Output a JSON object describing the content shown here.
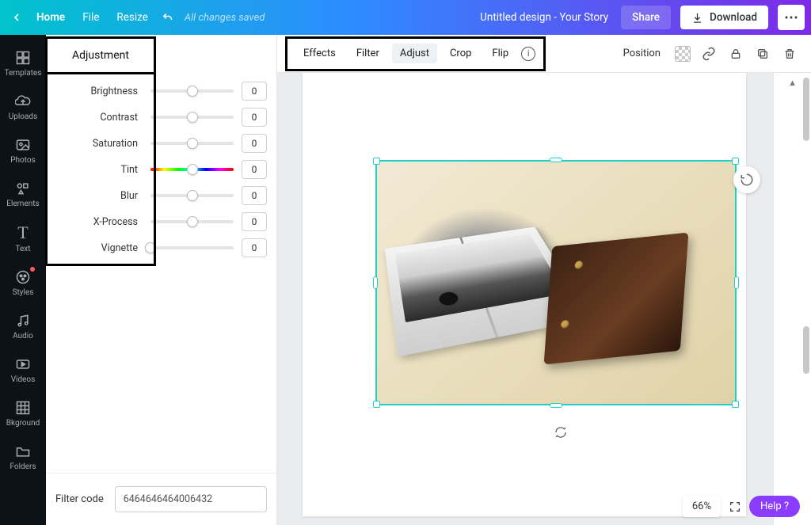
{
  "topbar": {
    "home": "Home",
    "file": "File",
    "resize": "Resize",
    "changes_saved": "All changes saved",
    "title": "Untitled design - Your Story",
    "share": "Share",
    "download": "Download"
  },
  "rail": {
    "templates": "Templates",
    "uploads": "Uploads",
    "photos": "Photos",
    "elements": "Elements",
    "text": "Text",
    "styles": "Styles",
    "audio": "Audio",
    "videos": "Videos",
    "bkground": "Bkground",
    "folders": "Folders"
  },
  "adjust": {
    "heading": "Adjustment",
    "rows": [
      {
        "label": "Brightness",
        "value": "0",
        "thumb": "center"
      },
      {
        "label": "Contrast",
        "value": "0",
        "thumb": "center"
      },
      {
        "label": "Saturation",
        "value": "0",
        "thumb": "center"
      },
      {
        "label": "Tint",
        "value": "0",
        "thumb": "center",
        "hue": true
      },
      {
        "label": "Blur",
        "value": "0",
        "thumb": "center"
      },
      {
        "label": "X-Process",
        "value": "0",
        "thumb": "center"
      },
      {
        "label": "Vignette",
        "value": "0",
        "thumb": "left"
      }
    ],
    "filter_code_label": "Filter code",
    "filter_code_value": "6464646464006432"
  },
  "contextbar": {
    "effects": "Effects",
    "filter": "Filter",
    "adjust": "Adjust",
    "crop": "Crop",
    "flip": "Flip",
    "position": "Position"
  },
  "footer": {
    "zoom": "66%",
    "help": "Help  ?"
  }
}
